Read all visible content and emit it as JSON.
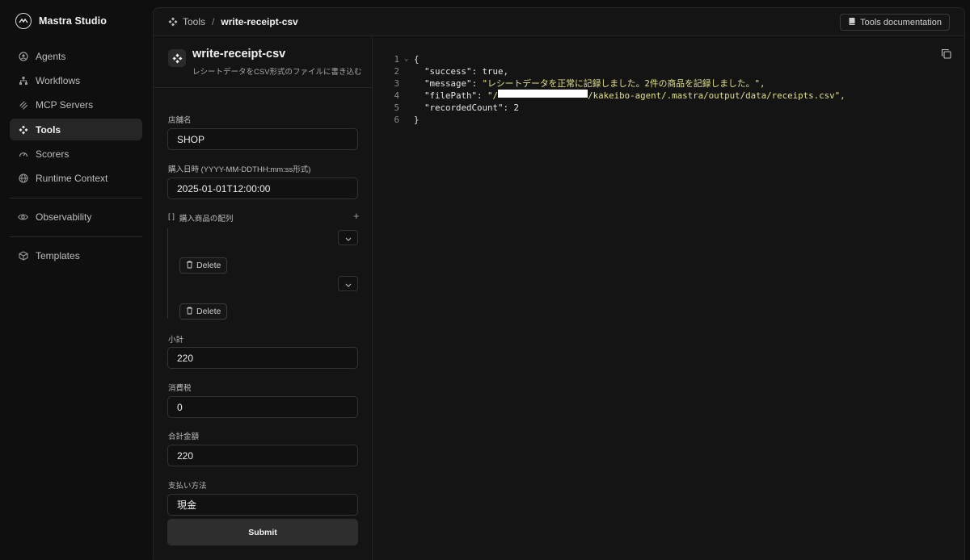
{
  "app": {
    "brand_name": "Mastra Studio"
  },
  "sidebar": {
    "items": [
      {
        "label": "Agents",
        "icon": "agents-icon"
      },
      {
        "label": "Workflows",
        "icon": "workflows-icon"
      },
      {
        "label": "MCP Servers",
        "icon": "mcp-icon"
      },
      {
        "label": "Tools",
        "icon": "tools-icon",
        "active": true
      },
      {
        "label": "Scorers",
        "icon": "scorers-icon"
      },
      {
        "label": "Runtime Context",
        "icon": "globe-icon"
      }
    ],
    "secondary": [
      {
        "label": "Observability",
        "icon": "eye-icon"
      }
    ],
    "tertiary": [
      {
        "label": "Templates",
        "icon": "box-icon"
      }
    ]
  },
  "topbar": {
    "breadcrumb_root": "Tools",
    "breadcrumb_sep": "/",
    "breadcrumb_current": "write-receipt-csv",
    "docs_label": "Tools documentation"
  },
  "tool": {
    "name": "write-receipt-csv",
    "description": "レシートデータをCSV形式のファイルに書き込む"
  },
  "form": {
    "store_label": "店舗名",
    "store_value": "SHOP",
    "date_label": "購入日時 (YYYY-MM-DDTHH:mm:ss形式)",
    "date_value": "2025-01-01T12:00:00",
    "items_prefix": "[ ]",
    "items_label": "購入商品の配列",
    "add_symbol": "+",
    "delete_label": "Delete",
    "subtotal_label": "小計",
    "subtotal_value": "220",
    "tax_label": "消費税",
    "tax_value": "0",
    "total_label": "合計金額",
    "total_value": "220",
    "payment_label": "支払い方法",
    "payment_value": "現金",
    "submit_label": "Submit"
  },
  "output": {
    "lines": [
      {
        "n": "1",
        "text": "{"
      },
      {
        "n": "2",
        "key": "\"success\"",
        "value": "true,"
      },
      {
        "n": "3",
        "key": "\"message\"",
        "value": "\"レシートデータを正常に記録しました。2件の商品を記録しました。\","
      },
      {
        "n": "4",
        "key": "\"filePath\"",
        "value_pre": "\"/",
        "value_post": "/kakeibo-agent/.mastra/output/data/receipts.csv\","
      },
      {
        "n": "5",
        "key": "\"recordedCount\"",
        "value": "2"
      },
      {
        "n": "6",
        "text": "}"
      }
    ]
  }
}
